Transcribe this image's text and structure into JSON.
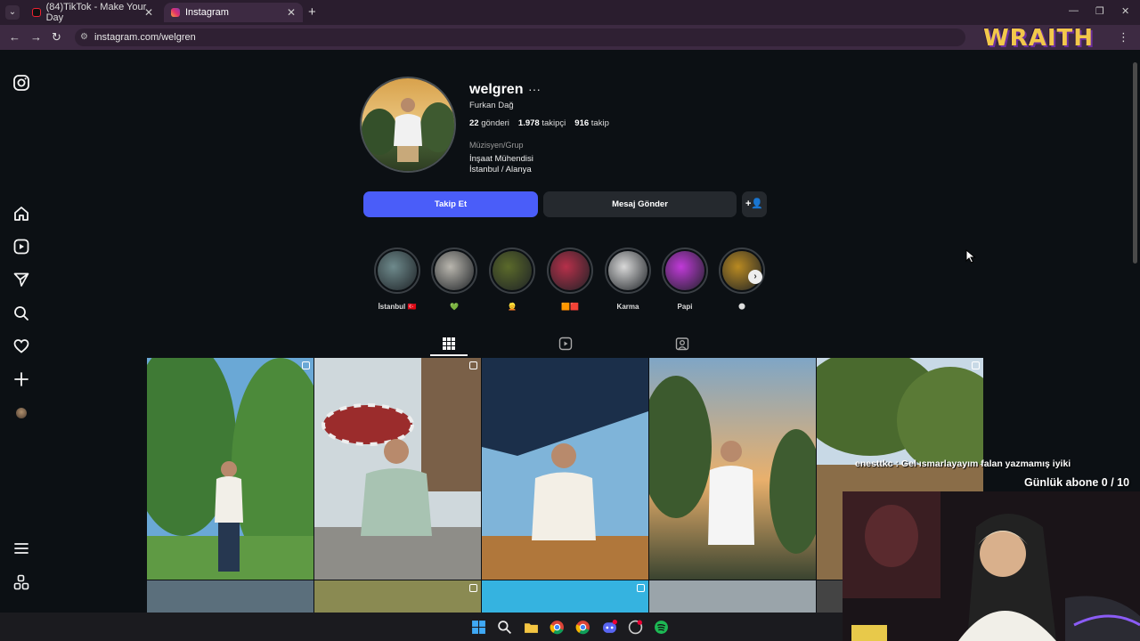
{
  "browser": {
    "tabs": [
      {
        "title": "(84)TikTok - Make Your Day",
        "active": false
      },
      {
        "title": "Instagram",
        "active": true
      }
    ],
    "url": "instagram.com/welgren"
  },
  "overlay": {
    "brand": "WRAITH",
    "chat_message": "enesttkc : Gel ısmarlayayım falan yazmamış iyiki",
    "sub_goal": "Günlük abone 0 / 10"
  },
  "sidebar": {
    "icons": [
      "instagram-logo-icon",
      "home-icon",
      "reels-icon",
      "send-icon",
      "search-icon",
      "heart-icon",
      "plus-icon",
      "profile-avatar",
      "menu-icon",
      "apps-icon"
    ]
  },
  "profile": {
    "username": "welgren",
    "full_name": "Furkan Dağ",
    "posts_count": "22",
    "posts_label": "gönderi",
    "followers_count": "1.978",
    "followers_label": "takipçi",
    "following_count": "916",
    "following_label": "takip",
    "category": "Müzisyen/Grup",
    "bio_line1": "İnşaat Mühendisi",
    "bio_line2": "İstanbul / Alanya"
  },
  "actions": {
    "follow": "Takip Et",
    "message": "Mesaj Gönder"
  },
  "highlights": [
    {
      "label": "İstanbul 🇹🇷",
      "color": "#6e8a8c"
    },
    {
      "label": "💚",
      "color": "#b9b6ae"
    },
    {
      "label": "👱",
      "color": "#5b6a2a"
    },
    {
      "label": "🟧🟥",
      "color": "#b6304a"
    },
    {
      "label": "Karma",
      "color": "#d8d8d8"
    },
    {
      "label": "Papi",
      "color": "#c03ad8"
    },
    {
      "label": "🌑",
      "color": "#b98a22"
    }
  ],
  "colors": {
    "accent": "#4a5df9",
    "background": "#0c1014",
    "button_secondary": "#25292e"
  }
}
